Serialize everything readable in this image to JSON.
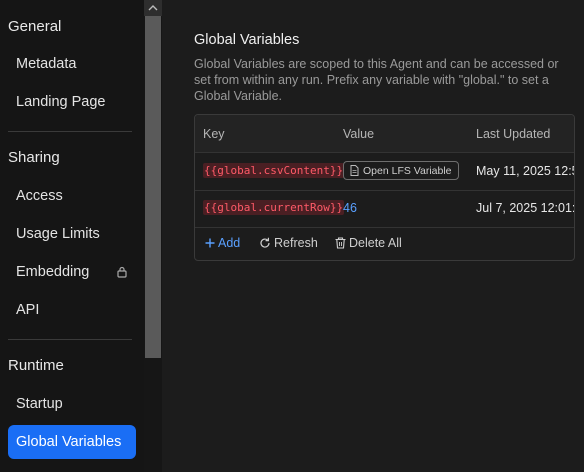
{
  "sidebar": {
    "groups": {
      "general": "General",
      "sharing": "Sharing",
      "runtime": "Runtime"
    },
    "items": {
      "metadata": "Metadata",
      "landing_page": "Landing Page",
      "access": "Access",
      "usage_limits": "Usage Limits",
      "embedding": "Embedding",
      "api": "API",
      "startup": "Startup",
      "global_variables": "Global Variables"
    },
    "active_item": "global_variables",
    "accent_color": "#1a6ef5"
  },
  "section": {
    "title": "Global Variables",
    "description": "Global Variables are scoped to this Agent and can be accessed or set from within any run. Prefix any variable with \"global.\" to set a Global Variable."
  },
  "table": {
    "columns": {
      "key": "Key",
      "value": "Value",
      "last_updated": "Last Updated"
    },
    "rows": [
      {
        "key": "{{global.csvContent}}",
        "value_button": "Open LFS Variable",
        "last_updated": "May 11, 2025 12:5"
      },
      {
        "key": "{{global.currentRow}}",
        "value": "46",
        "last_updated": "Jul 7, 2025 12:01:"
      }
    ],
    "actions": {
      "add": "Add",
      "refresh": "Refresh",
      "delete_all": "Delete All"
    }
  },
  "icons": [
    "lock-icon",
    "file-icon",
    "plus-icon",
    "refresh-icon",
    "trash-icon"
  ]
}
